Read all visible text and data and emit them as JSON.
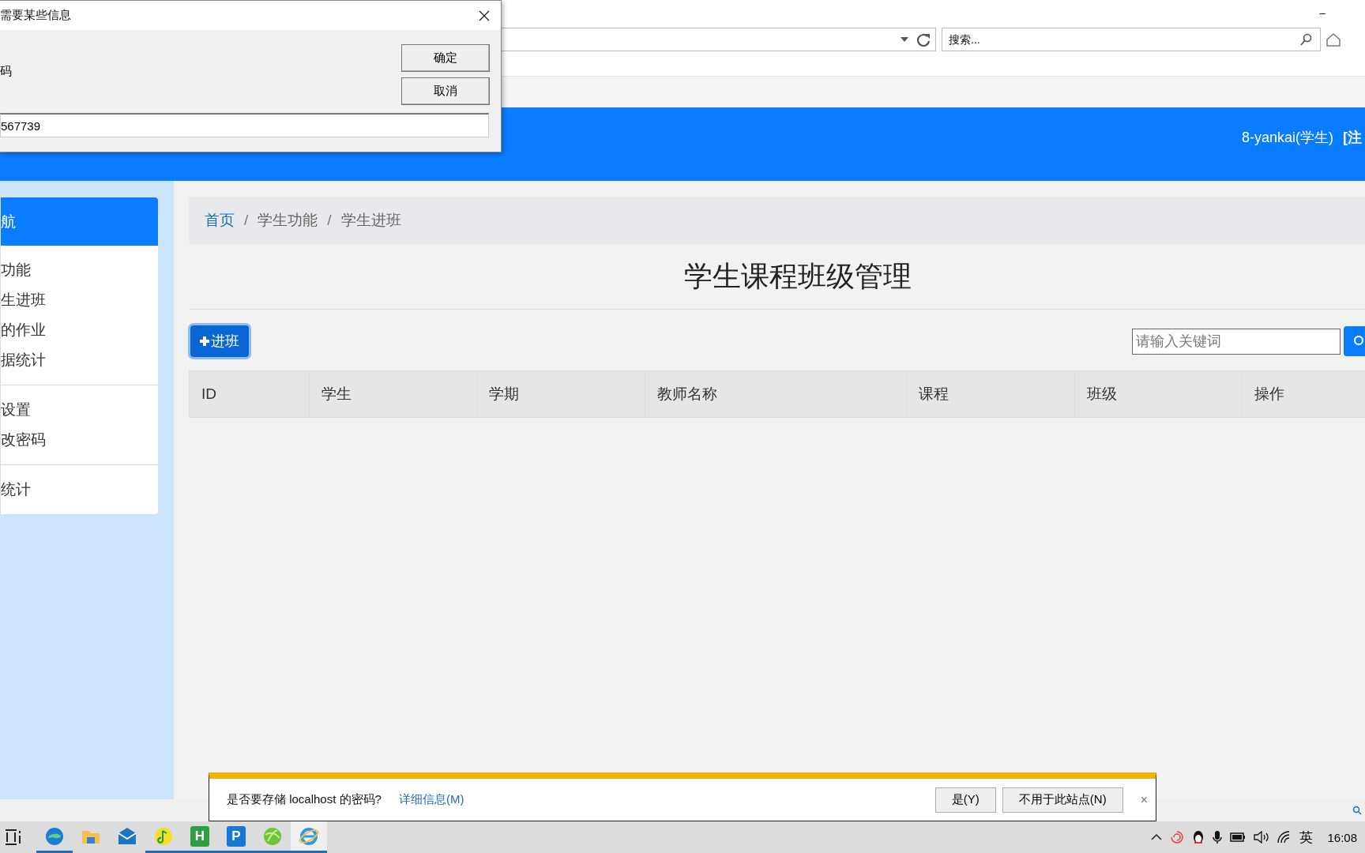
{
  "dialog": {
    "title": "需要某些信息",
    "label": "码",
    "input_value": "567739",
    "buttons": [
      "确定",
      "取消"
    ]
  },
  "browser": {
    "search_placeholder": "搜索...",
    "minimize": "–"
  },
  "header": {
    "user": "8-yankai(学生)",
    "logout": "[注"
  },
  "sidebar": {
    "title": "航",
    "groups": [
      [
        "功能",
        "生进班",
        "的作业",
        "据统计"
      ],
      [
        "设置",
        "改密码"
      ],
      [
        "统计"
      ]
    ]
  },
  "breadcrumb": {
    "separator": "/",
    "items": [
      {
        "label": "首页",
        "kind": "link"
      },
      {
        "label": "学生功能",
        "kind": "text"
      },
      {
        "label": "学生进班",
        "kind": "text"
      }
    ]
  },
  "page_title": "学生课程班级管理",
  "add_button": {
    "label": "进班"
  },
  "search": {
    "placeholder": "请输入关键词"
  },
  "table": {
    "columns": [
      "ID",
      "学生",
      "学期",
      "教师名称",
      "课程",
      "班级",
      "操作"
    ]
  },
  "password_bar": {
    "message": "是否要存储 localhost 的密码?",
    "link": "详细信息(M)",
    "buttons": [
      "是(Y)",
      "不用于此站点(N)"
    ],
    "close": "×"
  },
  "taskbar": {
    "apps": [
      {
        "kind": "edge",
        "running": true,
        "selected": false
      },
      {
        "kind": "folder",
        "running": false,
        "selected": false
      },
      {
        "kind": "mail",
        "running": false,
        "selected": false
      },
      {
        "kind": "music",
        "running": true,
        "selected": false
      },
      {
        "kind": "letter",
        "glyph": "H",
        "running": true,
        "selected": false
      },
      {
        "kind": "letter",
        "glyph": "P",
        "running": true,
        "selected": false
      },
      {
        "kind": "ball",
        "running": true,
        "selected": false
      },
      {
        "kind": "ie",
        "running": true,
        "selected": true
      }
    ],
    "ime": "英",
    "time": "16:08"
  }
}
